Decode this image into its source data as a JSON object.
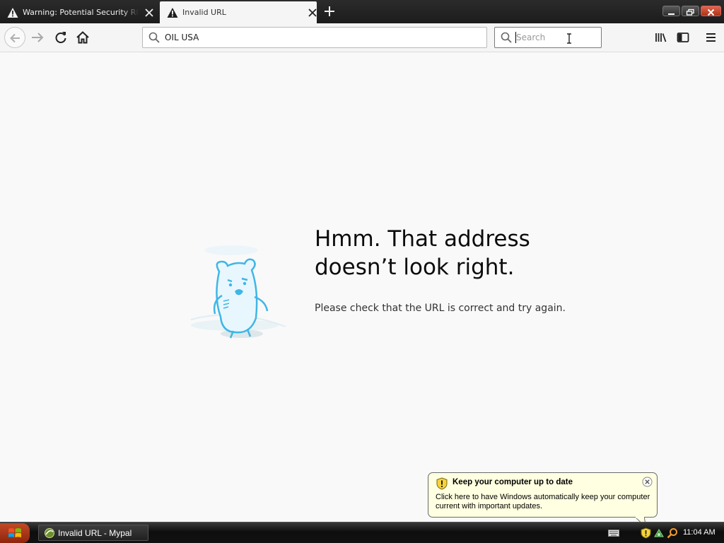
{
  "browser": {
    "tabs": [
      {
        "label": "Warning: Potential Security Risk Ahead",
        "active": false
      },
      {
        "label": "Invalid URL",
        "active": true
      }
    ],
    "new_tab_icon": "plus-icon",
    "window_controls": [
      "minimize-icon",
      "restore-icon",
      "close-icon"
    ]
  },
  "toolbar": {
    "url_value": "OIL USA",
    "search_placeholder": "Search",
    "icons": [
      "back-arrow-icon",
      "forward-arrow-icon",
      "reload-icon",
      "home-icon",
      "library-icon",
      "sidebar-icon",
      "hamburger-menu-icon"
    ]
  },
  "error_page": {
    "title": "Hmm. That address doesn’t look right.",
    "description": "Please check that the URL is correct and try again.",
    "illustration": "confused-bear-illustration"
  },
  "notification": {
    "title": "Keep your computer up to date",
    "body": "Click here to have Windows automatically keep your computer current with important updates.",
    "icon": "security-shield-icon"
  },
  "taskbar": {
    "task_label": "Invalid URL - Mypal",
    "clock": "11:04 AM"
  },
  "colors": {
    "page_bg": "#f9f9fa",
    "balloon_bg": "#ffffe1",
    "mascot_blue": "#3fb6e6"
  }
}
